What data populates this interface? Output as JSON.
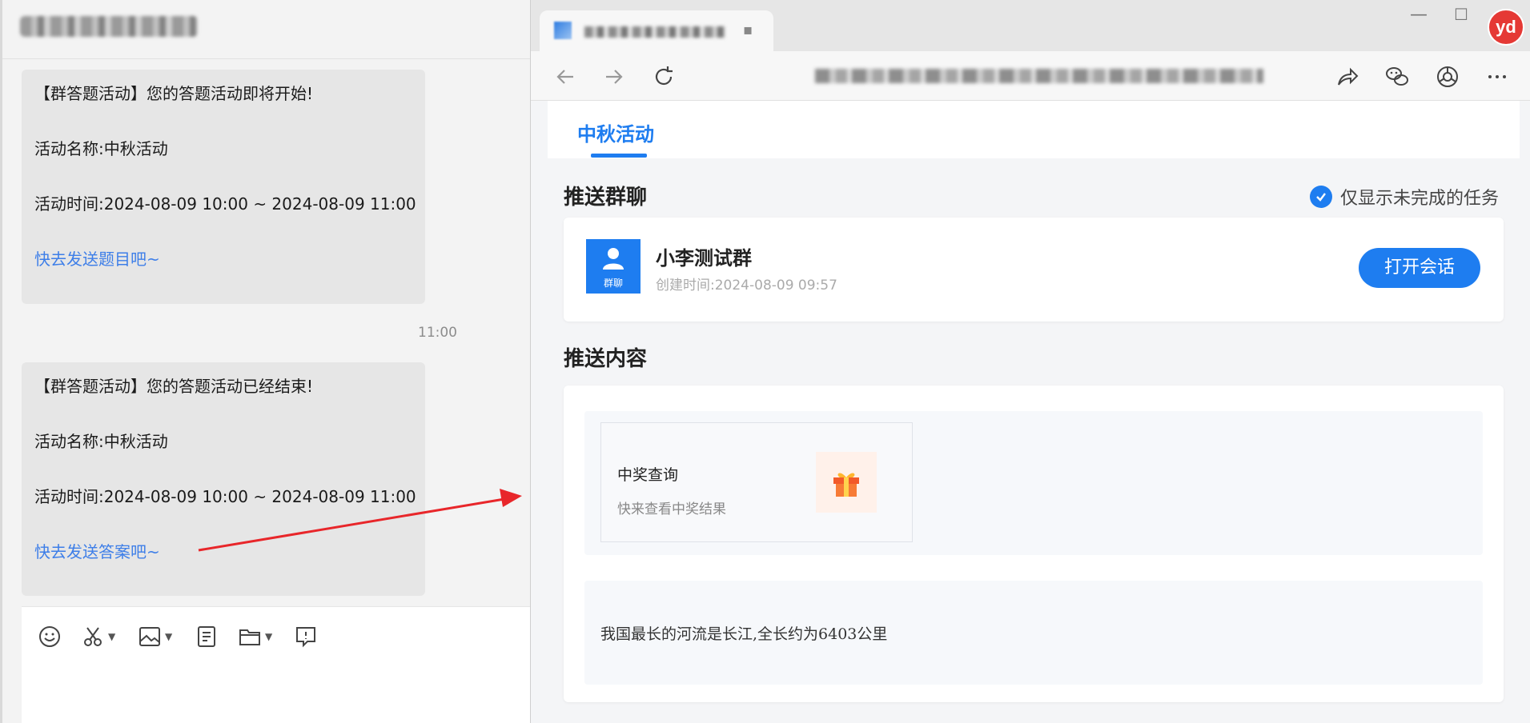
{
  "chat": {
    "messages": [
      {
        "header": "【群答题活动】您的答题活动即将开始!",
        "name_line": "活动名称:中秋活动",
        "time_line": "活动时间:2024-08-09 10:00 ~ 2024-08-09 11:00",
        "link": "快去发送题目吧~"
      },
      {
        "header": "【群答题活动】您的答题活动已经结束!",
        "name_line": "活动名称:中秋活动",
        "time_line": "活动时间:2024-08-09 10:00 ~ 2024-08-09 11:00",
        "link": "快去发送答案吧~"
      }
    ],
    "timestamp": "11:00",
    "composer_icons": [
      "emoji-icon",
      "scissors-icon",
      "image-icon",
      "note-icon",
      "folder-icon",
      "chat-bubble-icon"
    ]
  },
  "browser": {
    "avatar_text": "yd",
    "page": {
      "tab": "中秋活动",
      "group_section_title": "推送群聊",
      "filter_label": "仅显示未完成的任务",
      "filter_checked": true,
      "group": {
        "avatar_label": "群聊",
        "name": "小李测试群",
        "created": "创建时间:2024-08-09 09:57",
        "open_button": "打开会话"
      },
      "content_section_title": "推送内容",
      "push_card": {
        "title": "中奖查询",
        "subtitle": "快来查看中奖结果"
      },
      "push_text": "我国最长的河流是长江,全长约为6403公里"
    }
  },
  "colors": {
    "accent": "#1e7df0",
    "link": "#3d7ee8",
    "annotation": "#e8262a"
  }
}
